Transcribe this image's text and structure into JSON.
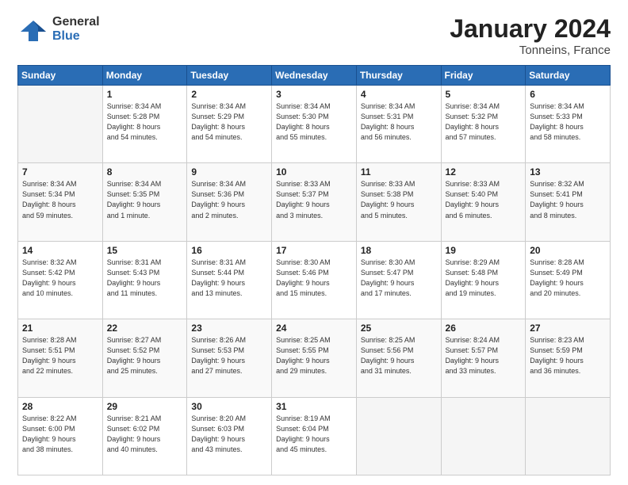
{
  "header": {
    "logo_general": "General",
    "logo_blue": "Blue",
    "month": "January 2024",
    "location": "Tonneins, France"
  },
  "weekdays": [
    "Sunday",
    "Monday",
    "Tuesday",
    "Wednesday",
    "Thursday",
    "Friday",
    "Saturday"
  ],
  "weeks": [
    [
      {
        "day": null,
        "info": null
      },
      {
        "day": "1",
        "info": "Sunrise: 8:34 AM\nSunset: 5:28 PM\nDaylight: 8 hours\nand 54 minutes."
      },
      {
        "day": "2",
        "info": "Sunrise: 8:34 AM\nSunset: 5:29 PM\nDaylight: 8 hours\nand 54 minutes."
      },
      {
        "day": "3",
        "info": "Sunrise: 8:34 AM\nSunset: 5:30 PM\nDaylight: 8 hours\nand 55 minutes."
      },
      {
        "day": "4",
        "info": "Sunrise: 8:34 AM\nSunset: 5:31 PM\nDaylight: 8 hours\nand 56 minutes."
      },
      {
        "day": "5",
        "info": "Sunrise: 8:34 AM\nSunset: 5:32 PM\nDaylight: 8 hours\nand 57 minutes."
      },
      {
        "day": "6",
        "info": "Sunrise: 8:34 AM\nSunset: 5:33 PM\nDaylight: 8 hours\nand 58 minutes."
      }
    ],
    [
      {
        "day": "7",
        "info": "Sunrise: 8:34 AM\nSunset: 5:34 PM\nDaylight: 8 hours\nand 59 minutes."
      },
      {
        "day": "8",
        "info": "Sunrise: 8:34 AM\nSunset: 5:35 PM\nDaylight: 9 hours\nand 1 minute."
      },
      {
        "day": "9",
        "info": "Sunrise: 8:34 AM\nSunset: 5:36 PM\nDaylight: 9 hours\nand 2 minutes."
      },
      {
        "day": "10",
        "info": "Sunrise: 8:33 AM\nSunset: 5:37 PM\nDaylight: 9 hours\nand 3 minutes."
      },
      {
        "day": "11",
        "info": "Sunrise: 8:33 AM\nSunset: 5:38 PM\nDaylight: 9 hours\nand 5 minutes."
      },
      {
        "day": "12",
        "info": "Sunrise: 8:33 AM\nSunset: 5:40 PM\nDaylight: 9 hours\nand 6 minutes."
      },
      {
        "day": "13",
        "info": "Sunrise: 8:32 AM\nSunset: 5:41 PM\nDaylight: 9 hours\nand 8 minutes."
      }
    ],
    [
      {
        "day": "14",
        "info": "Sunrise: 8:32 AM\nSunset: 5:42 PM\nDaylight: 9 hours\nand 10 minutes."
      },
      {
        "day": "15",
        "info": "Sunrise: 8:31 AM\nSunset: 5:43 PM\nDaylight: 9 hours\nand 11 minutes."
      },
      {
        "day": "16",
        "info": "Sunrise: 8:31 AM\nSunset: 5:44 PM\nDaylight: 9 hours\nand 13 minutes."
      },
      {
        "day": "17",
        "info": "Sunrise: 8:30 AM\nSunset: 5:46 PM\nDaylight: 9 hours\nand 15 minutes."
      },
      {
        "day": "18",
        "info": "Sunrise: 8:30 AM\nSunset: 5:47 PM\nDaylight: 9 hours\nand 17 minutes."
      },
      {
        "day": "19",
        "info": "Sunrise: 8:29 AM\nSunset: 5:48 PM\nDaylight: 9 hours\nand 19 minutes."
      },
      {
        "day": "20",
        "info": "Sunrise: 8:28 AM\nSunset: 5:49 PM\nDaylight: 9 hours\nand 20 minutes."
      }
    ],
    [
      {
        "day": "21",
        "info": "Sunrise: 8:28 AM\nSunset: 5:51 PM\nDaylight: 9 hours\nand 22 minutes."
      },
      {
        "day": "22",
        "info": "Sunrise: 8:27 AM\nSunset: 5:52 PM\nDaylight: 9 hours\nand 25 minutes."
      },
      {
        "day": "23",
        "info": "Sunrise: 8:26 AM\nSunset: 5:53 PM\nDaylight: 9 hours\nand 27 minutes."
      },
      {
        "day": "24",
        "info": "Sunrise: 8:25 AM\nSunset: 5:55 PM\nDaylight: 9 hours\nand 29 minutes."
      },
      {
        "day": "25",
        "info": "Sunrise: 8:25 AM\nSunset: 5:56 PM\nDaylight: 9 hours\nand 31 minutes."
      },
      {
        "day": "26",
        "info": "Sunrise: 8:24 AM\nSunset: 5:57 PM\nDaylight: 9 hours\nand 33 minutes."
      },
      {
        "day": "27",
        "info": "Sunrise: 8:23 AM\nSunset: 5:59 PM\nDaylight: 9 hours\nand 36 minutes."
      }
    ],
    [
      {
        "day": "28",
        "info": "Sunrise: 8:22 AM\nSunset: 6:00 PM\nDaylight: 9 hours\nand 38 minutes."
      },
      {
        "day": "29",
        "info": "Sunrise: 8:21 AM\nSunset: 6:02 PM\nDaylight: 9 hours\nand 40 minutes."
      },
      {
        "day": "30",
        "info": "Sunrise: 8:20 AM\nSunset: 6:03 PM\nDaylight: 9 hours\nand 43 minutes."
      },
      {
        "day": "31",
        "info": "Sunrise: 8:19 AM\nSunset: 6:04 PM\nDaylight: 9 hours\nand 45 minutes."
      },
      {
        "day": null,
        "info": null
      },
      {
        "day": null,
        "info": null
      },
      {
        "day": null,
        "info": null
      }
    ]
  ]
}
